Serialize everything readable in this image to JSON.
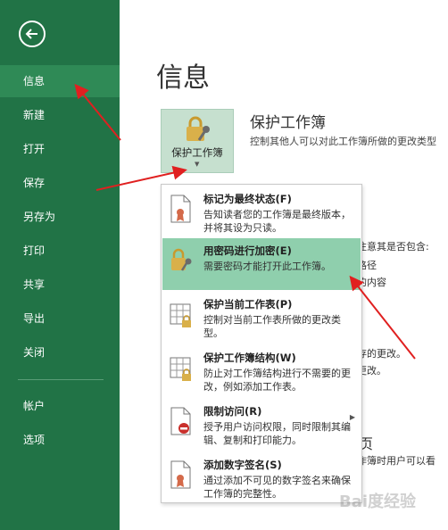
{
  "sidebar": {
    "items": [
      {
        "label": "信息"
      },
      {
        "label": "新建"
      },
      {
        "label": "打开"
      },
      {
        "label": "保存"
      },
      {
        "label": "另存为"
      },
      {
        "label": "打印"
      },
      {
        "label": "共享"
      },
      {
        "label": "导出"
      },
      {
        "label": "关闭"
      },
      {
        "label": "帐户"
      },
      {
        "label": "选项"
      }
    ]
  },
  "main": {
    "title": "信息",
    "protect_tile": {
      "label": "保护工作簿"
    },
    "section": {
      "title": "保护工作簿",
      "description": "控制其他人可以对此工作簿所做的更改类型"
    },
    "background_fragments": [
      "注意其是否包含:",
      "路径",
      "的内容",
      "存的更改。",
      "更改。",
      "页",
      "作簿时用户可以看"
    ]
  },
  "dropdown": {
    "items": [
      {
        "title": "标记为最终状态(F)",
        "description": "告知读者您的工作簿是最终版本，并将其设为只读。"
      },
      {
        "title": "用密码进行加密(E)",
        "description": "需要密码才能打开此工作簿。"
      },
      {
        "title": "保护当前工作表(P)",
        "description": "控制对当前工作表所做的更改类型。"
      },
      {
        "title": "保护工作簿结构(W)",
        "description": "防止对工作簿结构进行不需要的更改，例如添加工作表。"
      },
      {
        "title": "限制访问(R)",
        "description": "授予用户访问权限，同时限制其编辑、复制和打印能力。"
      },
      {
        "title": "添加数字签名(S)",
        "description": "通过添加不可见的数字签名来确保工作簿的完整性。"
      }
    ]
  },
  "watermark": "Bai度经验",
  "colors": {
    "sidebar": "#217346",
    "sidebar_active": "#2f8a56",
    "highlight": "#8fcfad",
    "arrow": "#e02020",
    "lock": "#d9b04a"
  }
}
